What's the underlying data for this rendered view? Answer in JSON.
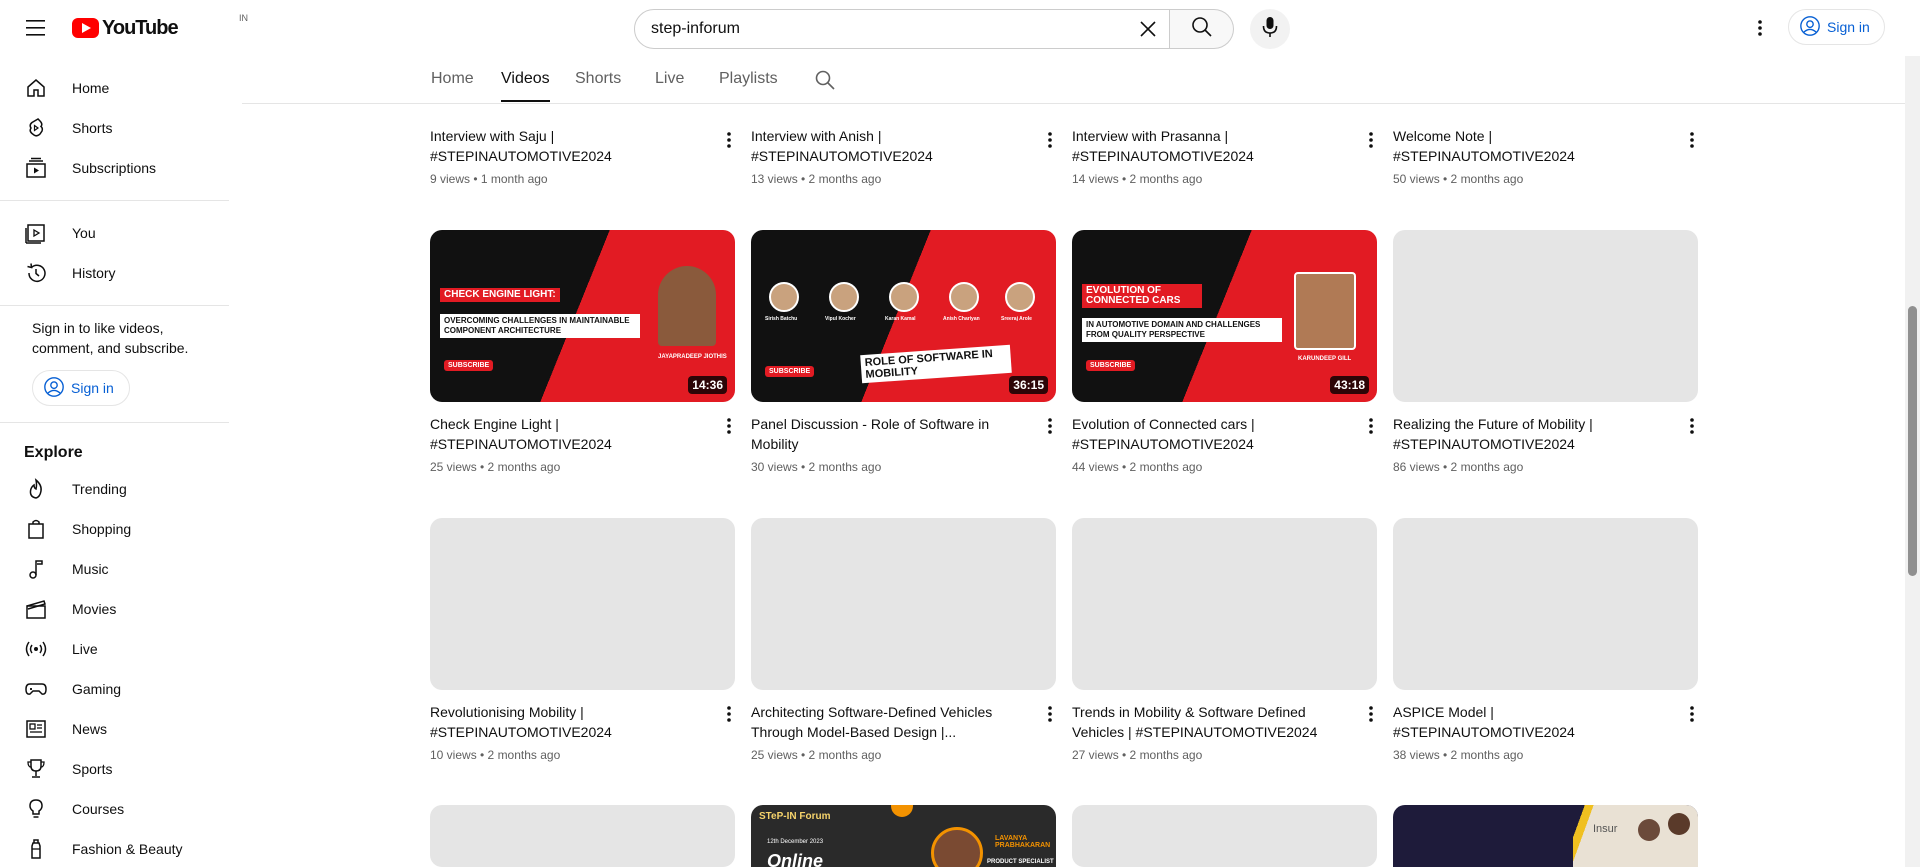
{
  "header": {
    "logo_text": "YouTube",
    "country_code": "IN",
    "search_value": "step-inforum",
    "signin_label": "Sign in"
  },
  "sidebar": {
    "main": [
      {
        "label": "Home",
        "icon": "home-icon"
      },
      {
        "label": "Shorts",
        "icon": "shorts-icon"
      },
      {
        "label": "Subscriptions",
        "icon": "subscriptions-icon"
      }
    ],
    "you": [
      {
        "label": "You",
        "icon": "you-icon"
      },
      {
        "label": "History",
        "icon": "history-icon"
      }
    ],
    "signin_prompt": "Sign in to like videos, comment, and subscribe.",
    "signin_label": "Sign in",
    "explore_heading": "Explore",
    "explore": [
      {
        "label": "Trending",
        "icon": "trending-icon"
      },
      {
        "label": "Shopping",
        "icon": "shopping-icon"
      },
      {
        "label": "Music",
        "icon": "music-icon"
      },
      {
        "label": "Movies",
        "icon": "movies-icon"
      },
      {
        "label": "Live",
        "icon": "live-icon"
      },
      {
        "label": "Gaming",
        "icon": "gaming-icon"
      },
      {
        "label": "News",
        "icon": "news-icon"
      },
      {
        "label": "Sports",
        "icon": "sports-icon"
      },
      {
        "label": "Courses",
        "icon": "courses-icon"
      },
      {
        "label": "Fashion & Beauty",
        "icon": "fashion-icon"
      }
    ]
  },
  "tabs": [
    {
      "label": "Home",
      "active": false
    },
    {
      "label": "Videos",
      "active": true
    },
    {
      "label": "Shorts",
      "active": false
    },
    {
      "label": "Live",
      "active": false
    },
    {
      "label": "Playlists",
      "active": false
    }
  ],
  "videos": {
    "row1": [
      {
        "title": "Interview with Saju | #STEPINAUTOMOTIVE2024",
        "meta": "9 views • 1 month ago"
      },
      {
        "title": "Interview with Anish | #STEPINAUTOMOTIVE2024",
        "meta": "13 views • 2 months ago"
      },
      {
        "title": "Interview with Prasanna | #STEPINAUTOMOTIVE2024",
        "meta": "14 views • 2 months ago"
      },
      {
        "title": "Welcome Note | #STEPINAUTOMOTIVE2024",
        "meta": "50 views • 2 months ago"
      }
    ],
    "row2": [
      {
        "title": "Check Engine Light | #STEPINAUTOMOTIVE2024",
        "meta": "25 views • 2 months ago",
        "duration": "14:36",
        "thumb_headline": "CHECK ENGINE LIGHT:",
        "thumb_sub": "OVERCOMING CHALLENGES IN MAINTAINABLE COMPONENT ARCHITECTURE",
        "thumb_name": "JAYAPRADEEP JIOTHIS",
        "thumb_subscribe": "SUBSCRIBE"
      },
      {
        "title": "Panel Discussion - Role of Software in Mobility",
        "meta": "30 views • 2 months ago",
        "duration": "36:15",
        "thumb_headline": "ROLE OF SOFTWARE IN MOBILITY",
        "thumb_subscribe": "SUBSCRIBE",
        "thumb_people": [
          "Sirish Batchu",
          "Vipul Kocher",
          "Karan Kamal",
          "Anish Chariyan",
          "Sreeraj Arole"
        ]
      },
      {
        "title": "Evolution of Connected cars | #STEPINAUTOMOTIVE2024",
        "meta": "44 views • 2 months ago",
        "duration": "43:18",
        "thumb_headline": "EVOLUTION OF CONNECTED CARS",
        "thumb_sub": "IN AUTOMOTIVE DOMAIN AND CHALLENGES FROM QUALITY PERSPECTIVE",
        "thumb_name": "KARUNDEEP GILL",
        "thumb_subscribe": "SUBSCRIBE"
      },
      {
        "title": "Realizing the Future of Mobility | #STEPINAUTOMOTIVE2024",
        "meta": "86 views • 2 months ago"
      }
    ],
    "row3": [
      {
        "title": "Revolutionising Mobility | #STEPINAUTOMOTIVE2024",
        "meta": "10 views • 2 months ago"
      },
      {
        "title": "Architecting Software-Defined Vehicles Through Model-Based Design |...",
        "meta": "25 views • 2 months ago"
      },
      {
        "title": "Trends in Mobility & Software Defined Vehicles | #STEPINAUTOMOTIVE2024",
        "meta": "27 views • 2 months ago"
      },
      {
        "title": "ASPICE Model | #STEPINAUTOMOTIVE2024",
        "meta": "38 views • 2 months ago"
      }
    ],
    "row4": [
      {
        "thumb_text": ""
      },
      {
        "thumb_text": "STeP-IN Forum",
        "thumb_date": "12th December 2023",
        "thumb_word": "Online",
        "thumb_name": "LAVANYA PRABHAKARAN",
        "thumb_role": "PRODUCT SPECIALIST"
      },
      {
        "thumb_text": ""
      },
      {
        "thumb_text": "Insur"
      }
    ]
  },
  "colors": {
    "brand_red": "#ff0000",
    "link_blue": "#065fd4",
    "thumb_red": "#e21b23"
  }
}
